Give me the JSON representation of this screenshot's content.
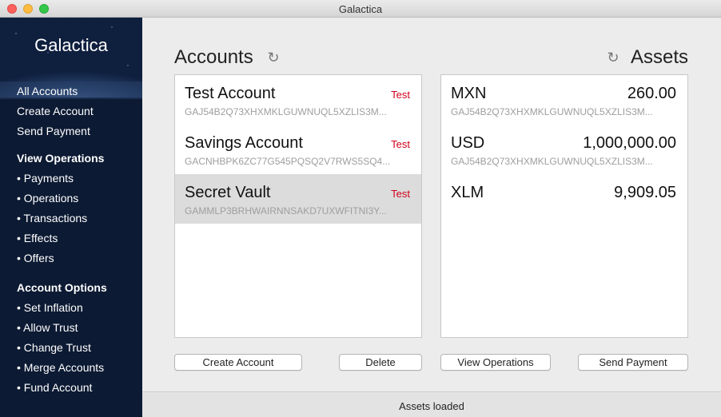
{
  "window": {
    "title": "Galactica"
  },
  "sidebar": {
    "brand": "Galactica",
    "items": [
      {
        "label": "All Accounts"
      },
      {
        "label": "Create Account"
      },
      {
        "label": "Send Payment"
      }
    ],
    "view_operations": {
      "heading": "View Operations",
      "items": [
        {
          "label": "• Payments"
        },
        {
          "label": "• Operations"
        },
        {
          "label": "• Transactions"
        },
        {
          "label": "• Effects"
        },
        {
          "label": "• Offers"
        }
      ]
    },
    "account_options": {
      "heading": "Account Options",
      "items": [
        {
          "label": "• Set Inflation"
        },
        {
          "label": "• Allow Trust"
        },
        {
          "label": "• Change Trust"
        },
        {
          "label": "• Merge Accounts"
        },
        {
          "label": "• Fund Account"
        }
      ]
    }
  },
  "accounts": {
    "title": "Accounts",
    "refresh_icon": "refresh-icon",
    "list": [
      {
        "name": "Test Account",
        "tag": "Test",
        "address": "GAJ54B2Q73XHXMKLGUWNUQL5XZLIS3M..."
      },
      {
        "name": "Savings Account",
        "tag": "Test",
        "address": "GACNHBPK6ZC77G545PQSQ2V7RWS5SQ4..."
      },
      {
        "name": "Secret Vault",
        "tag": "Test",
        "address": "GAMMLP3BRHWAIRNNSAKD7UXWFITNI3Y..."
      }
    ],
    "selected_index": 2
  },
  "assets": {
    "title": "Assets",
    "refresh_icon": "refresh-icon",
    "list": [
      {
        "code": "MXN",
        "amount": "260.00",
        "issuer": "GAJ54B2Q73XHXMKLGUWNUQL5XZLIS3M..."
      },
      {
        "code": "USD",
        "amount": "1,000,000.00",
        "issuer": "GAJ54B2Q73XHXMKLGUWNUQL5XZLIS3M..."
      },
      {
        "code": "XLM",
        "amount": "9,909.05",
        "issuer": ""
      }
    ]
  },
  "buttons": {
    "create_account": "Create Account",
    "delete": "Delete",
    "view_operations": "View Operations",
    "send_payment": "Send Payment"
  },
  "status": {
    "text": "Assets loaded"
  },
  "colors": {
    "sidebar_bg": "#0c1a33",
    "tag_red": "#d0021b",
    "selection": "#dcdcdc"
  }
}
